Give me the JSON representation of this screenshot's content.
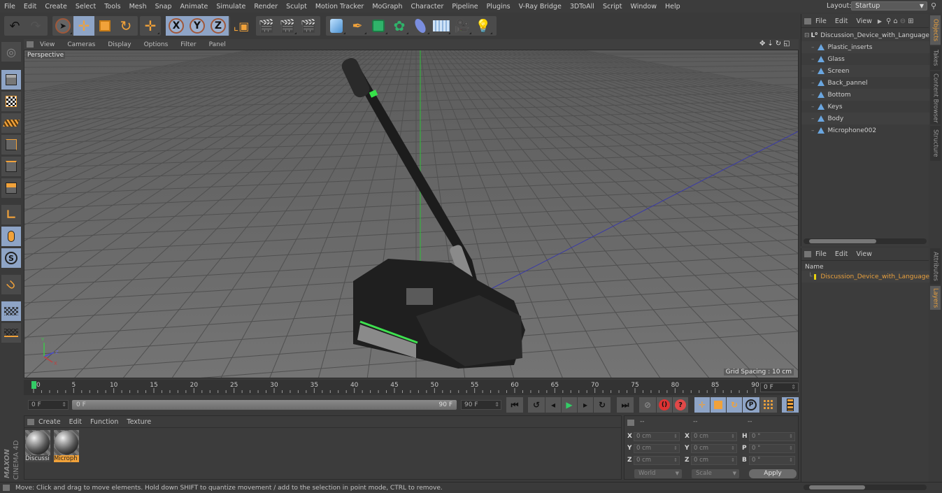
{
  "menubar": {
    "items": [
      "File",
      "Edit",
      "Create",
      "Select",
      "Tools",
      "Mesh",
      "Snap",
      "Animate",
      "Simulate",
      "Render",
      "Sculpt",
      "Motion Tracker",
      "MoGraph",
      "Character",
      "Pipeline",
      "Plugins",
      "V-Ray Bridge",
      "3DToAll",
      "Script",
      "Window",
      "Help"
    ],
    "layout_label": "Layout:",
    "layout_value": "Startup"
  },
  "toolbar": {
    "undo": "undo-icon",
    "redo": "redo-icon",
    "tools": [
      "live-selection",
      "move",
      "scale",
      "rotate",
      "recent-tool"
    ],
    "axes": [
      "X",
      "Y",
      "Z"
    ],
    "coord_system": "world-coordinate-icon",
    "render": [
      "render-view",
      "render-picture-viewer",
      "edit-render-settings"
    ],
    "objects": [
      "cube",
      "pen",
      "subdivision",
      "cloner",
      "deformer",
      "floor",
      "camera",
      "light"
    ]
  },
  "left_tools": [
    "make-editable",
    "model-mode",
    "texture-mode",
    "workplane-mode",
    "points-mode",
    "edges-mode",
    "polygons-mode",
    "axis-mode",
    "tweak-mode",
    "solo",
    "snap",
    "workplane-lock",
    "workplane-align"
  ],
  "viewport": {
    "menu": [
      "View",
      "Cameras",
      "Display",
      "Options",
      "Filter",
      "Panel"
    ],
    "camera_label": "Perspective",
    "grid_spacing": "Grid Spacing : 10 cm"
  },
  "timeline": {
    "ticks": [
      "0",
      "5",
      "10",
      "15",
      "20",
      "25",
      "30",
      "35",
      "40",
      "45",
      "50",
      "55",
      "60",
      "65",
      "70",
      "75",
      "80",
      "85",
      "90"
    ],
    "current_frame": "0 F",
    "start_field": "0 F",
    "range_start": "0 F",
    "range_end": "90 F",
    "end_field": "90 F",
    "playhead_frame": 0,
    "max_frame": 90
  },
  "materials": {
    "menu": [
      "Create",
      "Edit",
      "Function",
      "Texture"
    ],
    "items": [
      {
        "label": "Discussi",
        "selected": false
      },
      {
        "label": "Microph",
        "selected": true
      }
    ]
  },
  "coordinates": {
    "header": [
      "--",
      "--",
      "--"
    ],
    "rows": [
      {
        "l1": "X",
        "v1": "0 cm",
        "l2": "X",
        "v2": "0 cm",
        "l3": "H",
        "v3": "0 °"
      },
      {
        "l1": "Y",
        "v1": "0 cm",
        "l2": "Y",
        "v2": "0 cm",
        "l3": "P",
        "v3": "0 °"
      },
      {
        "l1": "Z",
        "v1": "0 cm",
        "l2": "Z",
        "v2": "0 cm",
        "l3": "B",
        "v3": "0 °"
      }
    ],
    "mode": "World",
    "type": "Scale",
    "apply": "Apply"
  },
  "objects_panel": {
    "menu": [
      "File",
      "Edit",
      "View"
    ],
    "root": "Discussion_Device_with_Language",
    "children": [
      "Plastic_inserts",
      "Glass",
      "Screen",
      "Back_pannel",
      "Bottom",
      "Keys",
      "Body",
      "Microphone002"
    ]
  },
  "layers_panel": {
    "menu": [
      "File",
      "Edit",
      "View"
    ],
    "column": "Name",
    "layers": [
      {
        "name": "Discussion_Device_with_Language",
        "color": "#e8d20f"
      }
    ]
  },
  "side_tabs": {
    "top": [
      "Objects",
      "Takes",
      "Content Browser",
      "Structure"
    ],
    "bottom": [
      "Attributes",
      "Layers"
    ]
  },
  "branding": {
    "vendor": "MAXON",
    "product": "CINEMA 4D"
  },
  "status": "Move: Click and drag to move elements. Hold down SHIFT to quantize movement / add to the selection in point mode, CTRL to remove.",
  "colors": {
    "accent": "#f1a23a",
    "active_button": "#8ea4c6",
    "selection_orange": "#e9a03d",
    "play_green": "#33cc66"
  }
}
